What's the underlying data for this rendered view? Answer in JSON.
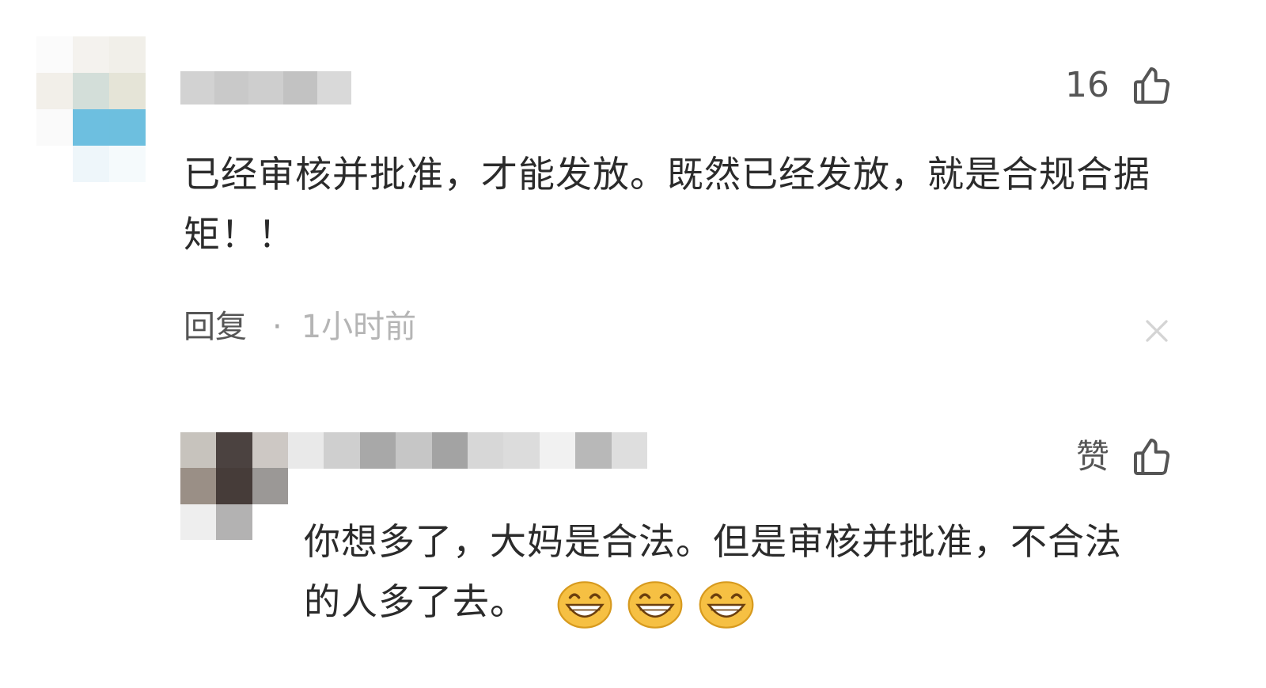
{
  "comment": {
    "likes": "16",
    "text": "已经审核并批准，才能发放。既然已经发放，就是合规合据矩！！",
    "reply_label": "回复",
    "separator": "·",
    "time": "1小时前",
    "close_icon": "close-icon"
  },
  "reply": {
    "like_label": "赞",
    "text": "你想多了，大妈是合法。但是审核并批准，不合法的人多了去。",
    "emojis": [
      "grin-emoji",
      "grin-emoji",
      "grin-emoji"
    ]
  },
  "icons": {
    "like": "thumbs-up-icon"
  },
  "colors": {
    "text": "#2b2b2b",
    "muted": "#555555",
    "timestamp": "#b5b5b5",
    "emoji": "#f3b63a"
  }
}
